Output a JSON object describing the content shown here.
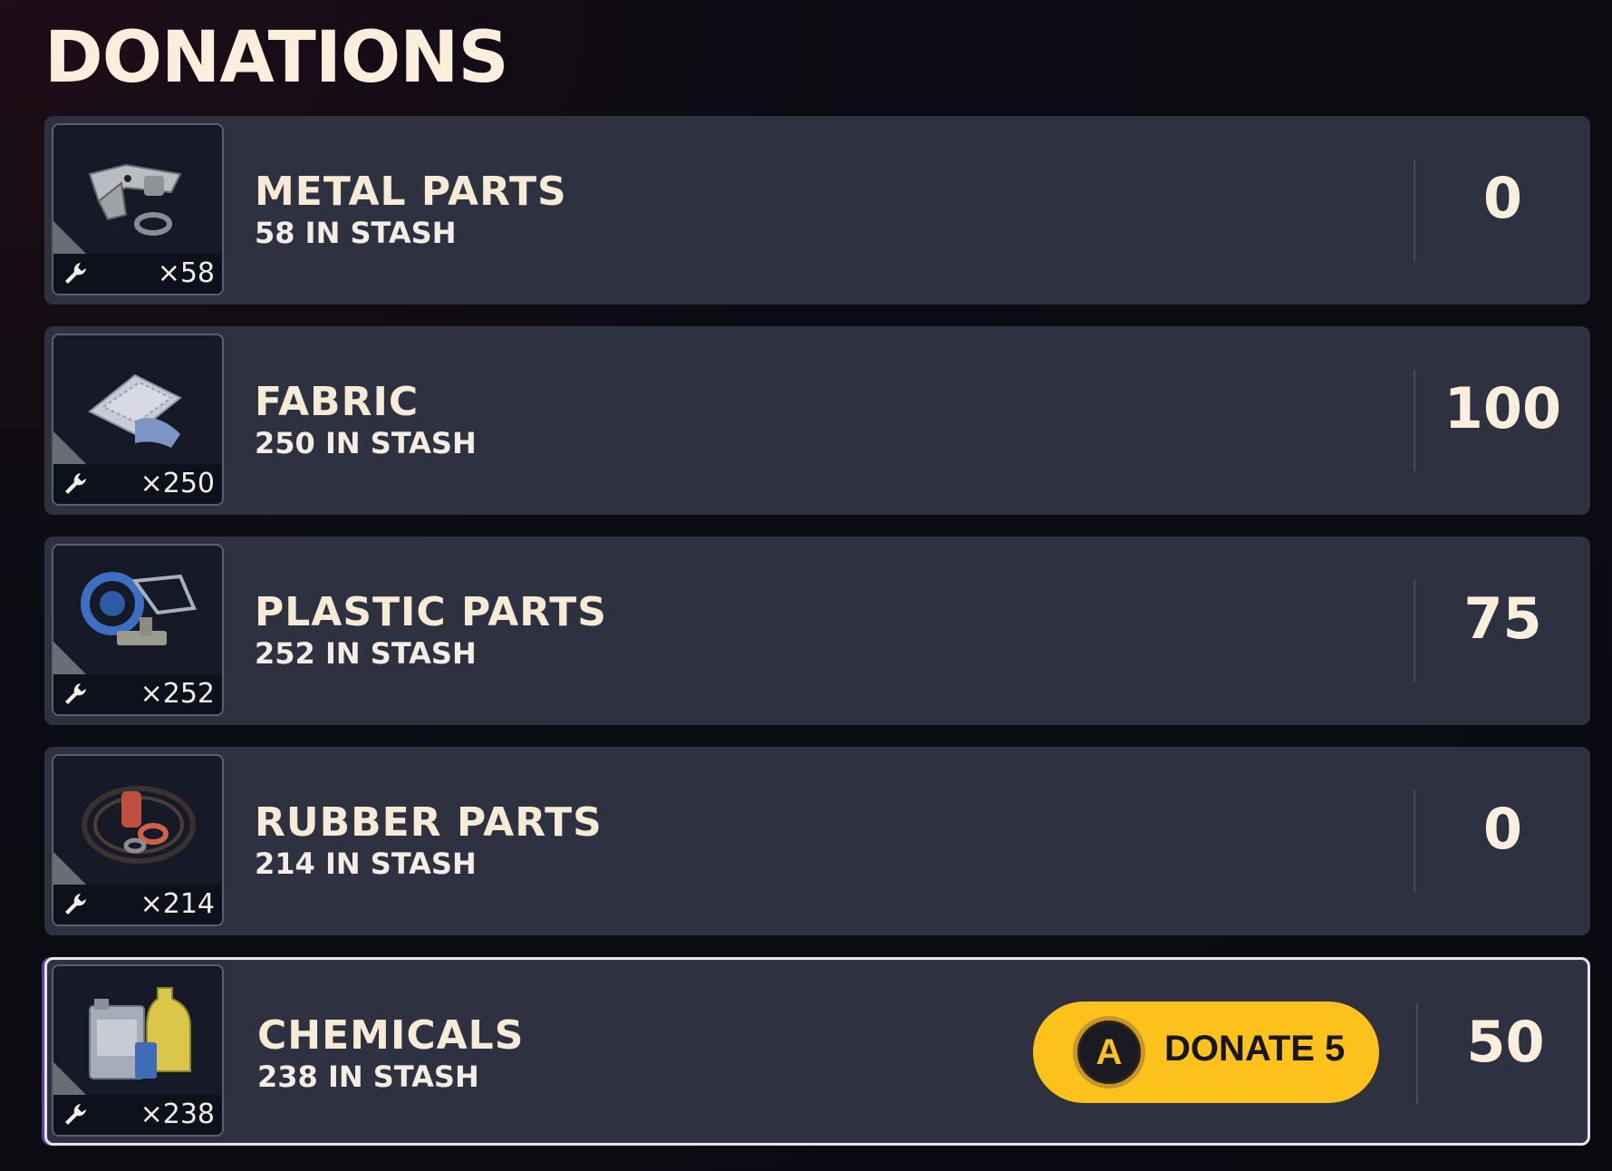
{
  "page": {
    "title": "DONATIONS"
  },
  "items": [
    {
      "name": "METAL PARTS",
      "stash": "58 IN STASH",
      "qty": "×58",
      "donated": "0",
      "icon": "metal-parts-icon"
    },
    {
      "name": "FABRIC",
      "stash": "250 IN STASH",
      "qty": "×250",
      "donated": "100",
      "icon": "fabric-icon"
    },
    {
      "name": "PLASTIC PARTS",
      "stash": "252 IN STASH",
      "qty": "×252",
      "donated": "75",
      "icon": "plastic-parts-icon"
    },
    {
      "name": "RUBBER PARTS",
      "stash": "214 IN STASH",
      "qty": "×214",
      "donated": "0",
      "icon": "rubber-parts-icon"
    },
    {
      "name": "CHEMICALS",
      "stash": "238 IN STASH",
      "qty": "×238",
      "donated": "50",
      "icon": "chemicals-icon",
      "selected": true
    }
  ],
  "donate_button": {
    "glyph": "A",
    "label": "DONATE 5"
  },
  "colors": {
    "accent": "#fcc21b",
    "row_bg": "#2e3140",
    "text": "#fbeedd"
  }
}
